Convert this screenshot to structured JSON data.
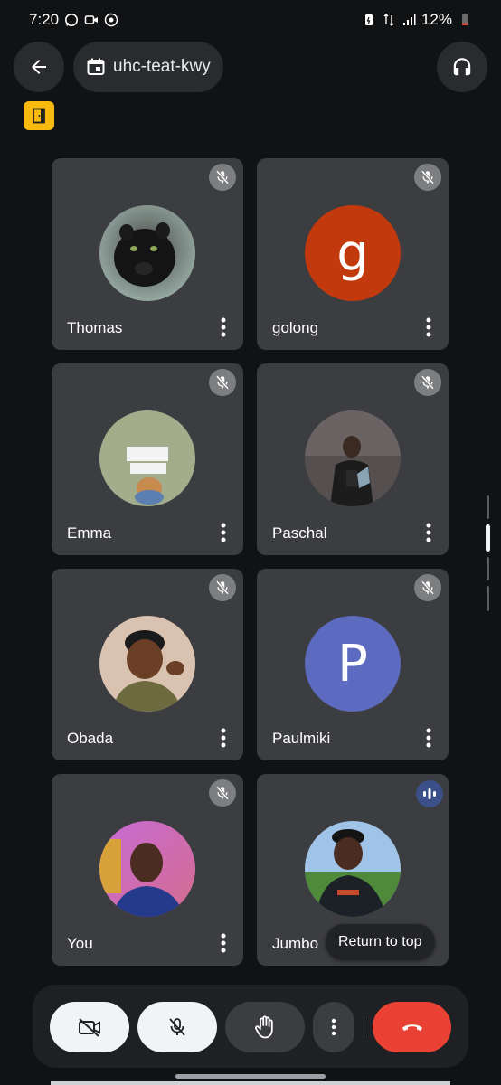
{
  "status_bar": {
    "time": "7:20",
    "battery": "12%"
  },
  "header": {
    "meeting_code": "uhc-teat-kwy"
  },
  "participants": [
    {
      "name": "Thomas",
      "avatar": "photo",
      "muted": true
    },
    {
      "name": "golong",
      "avatar": "letter",
      "letter": "g",
      "color": "#c2390e",
      "muted": true
    },
    {
      "name": "Emma",
      "avatar": "photo",
      "muted": true
    },
    {
      "name": "Paschal",
      "avatar": "photo",
      "muted": true
    },
    {
      "name": "Obada",
      "avatar": "photo",
      "muted": true
    },
    {
      "name": "Paulmiki",
      "avatar": "letter",
      "letter": "P",
      "color": "#5c6bc0",
      "muted": true
    },
    {
      "name": "You",
      "avatar": "photo",
      "muted": true
    },
    {
      "name": "Jumbo",
      "avatar": "photo",
      "muted": false,
      "speaking": true
    }
  ],
  "return_to_top_label": "Return to top",
  "colors": {
    "end_call": "#e94235",
    "host_badge": "#f9ba0f",
    "tile_bg": "#3c3d40"
  }
}
